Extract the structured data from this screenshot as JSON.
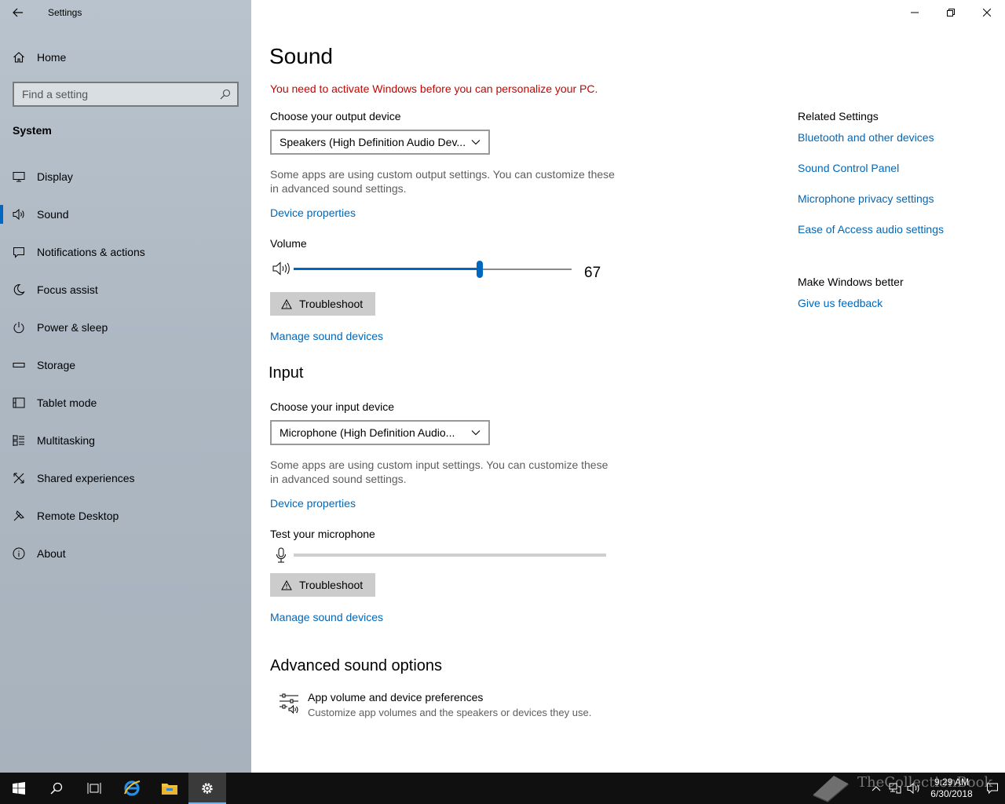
{
  "window": {
    "title": "Settings",
    "controls": {
      "minimize": "minimize",
      "maximize": "restore",
      "close": "close"
    }
  },
  "sidebar": {
    "home_label": "Home",
    "search_placeholder": "Find a setting",
    "section": "System",
    "items": [
      {
        "label": "Display",
        "icon": "monitor-icon",
        "active": false
      },
      {
        "label": "Sound",
        "icon": "speaker-icon",
        "active": true
      },
      {
        "label": "Notifications & actions",
        "icon": "message-icon",
        "active": false
      },
      {
        "label": "Focus assist",
        "icon": "moon-icon",
        "active": false
      },
      {
        "label": "Power & sleep",
        "icon": "power-icon",
        "active": false
      },
      {
        "label": "Storage",
        "icon": "drive-icon",
        "active": false
      },
      {
        "label": "Tablet mode",
        "icon": "tablet-icon",
        "active": false
      },
      {
        "label": "Multitasking",
        "icon": "multitask-icon",
        "active": false
      },
      {
        "label": "Shared experiences",
        "icon": "shared-icon",
        "active": false
      },
      {
        "label": "Remote Desktop",
        "icon": "remote-icon",
        "active": false
      },
      {
        "label": "About",
        "icon": "info-icon",
        "active": false
      }
    ]
  },
  "main": {
    "title": "Sound",
    "activation_warning": "You need to activate Windows before you can personalize your PC.",
    "output": {
      "label": "Choose your output device",
      "device": "Speakers (High Definition Audio Dev...",
      "note": "Some apps are using custom output settings. You can customize these in advanced sound settings.",
      "device_properties": "Device properties",
      "volume_label": "Volume",
      "volume": 67,
      "troubleshoot": "Troubleshoot",
      "manage": "Manage sound devices"
    },
    "input": {
      "heading": "Input",
      "label": "Choose your input device",
      "device": "Microphone (High Definition Audio...",
      "note": "Some apps are using custom input settings. You can customize these in advanced sound settings.",
      "device_properties": "Device properties",
      "test_label": "Test your microphone",
      "troubleshoot": "Troubleshoot",
      "manage": "Manage sound devices"
    },
    "advanced": {
      "heading": "Advanced sound options",
      "item_title": "App volume and device preferences",
      "item_sub": "Customize app volumes and the speakers or devices they use."
    }
  },
  "related": {
    "heading": "Related Settings",
    "links": [
      "Bluetooth and other devices",
      "Sound Control Panel",
      "Microphone privacy settings",
      "Ease of Access audio settings"
    ],
    "better_heading": "Make Windows better",
    "feedback": "Give us feedback"
  },
  "taskbar": {
    "time": "9:29 AM",
    "date": "6/30/2018",
    "watermark": "TheCollectionBook"
  },
  "colors": {
    "accent": "#0067c0",
    "link": "#0067b8",
    "warning": "#c50500",
    "sidebar_bg": "#b1bbc6",
    "taskbar_bg": "#101010"
  }
}
